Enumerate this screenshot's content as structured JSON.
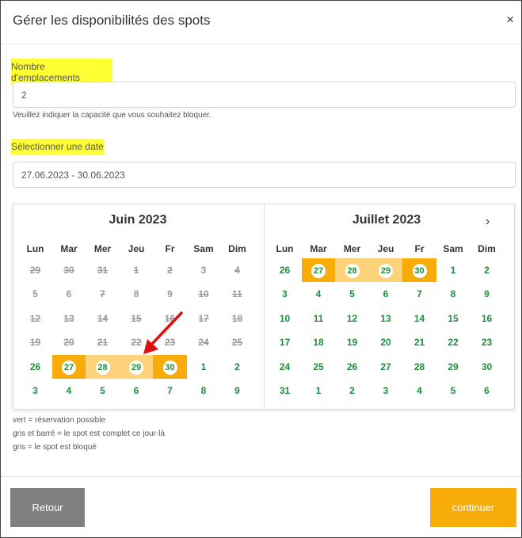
{
  "modal": {
    "title": "Gérer les disponibilités des spots",
    "close_label": "×"
  },
  "capacity": {
    "label": "Nombre d'emplacements",
    "value": "2",
    "help": "Veuillez indiquer la capacité que vous souhaitez bloquer."
  },
  "date": {
    "label": "Sélectionner une date",
    "value": "27.06.2023 - 30.06.2023"
  },
  "calendar": {
    "weekdays": [
      "Lun",
      "Mar",
      "Mer",
      "Jeu",
      "Fr",
      "Sam",
      "Dim"
    ],
    "next_label": "›",
    "months": [
      {
        "title": "Juin 2023",
        "weeks": [
          [
            {
              "d": "29",
              "s": "full"
            },
            {
              "d": "30",
              "s": "full"
            },
            {
              "d": "31",
              "s": "full"
            },
            {
              "d": "1",
              "s": "full"
            },
            {
              "d": "2",
              "s": "full"
            },
            {
              "d": "3",
              "s": "blocked"
            },
            {
              "d": "4",
              "s": "full"
            }
          ],
          [
            {
              "d": "5",
              "s": "blocked"
            },
            {
              "d": "6",
              "s": "blocked"
            },
            {
              "d": "7",
              "s": "full"
            },
            {
              "d": "8",
              "s": "blocked"
            },
            {
              "d": "9",
              "s": "blocked"
            },
            {
              "d": "10",
              "s": "full"
            },
            {
              "d": "11",
              "s": "full"
            }
          ],
          [
            {
              "d": "12",
              "s": "full"
            },
            {
              "d": "13",
              "s": "full"
            },
            {
              "d": "14",
              "s": "full"
            },
            {
              "d": "15",
              "s": "full"
            },
            {
              "d": "16",
              "s": "full"
            },
            {
              "d": "17",
              "s": "full"
            },
            {
              "d": "18",
              "s": "full"
            }
          ],
          [
            {
              "d": "19",
              "s": "full"
            },
            {
              "d": "20",
              "s": "full"
            },
            {
              "d": "21",
              "s": "full"
            },
            {
              "d": "22",
              "s": "full"
            },
            {
              "d": "23",
              "s": "full"
            },
            {
              "d": "24",
              "s": "full"
            },
            {
              "d": "25",
              "s": "full"
            }
          ],
          [
            {
              "d": "26",
              "s": "avail"
            },
            {
              "d": "27",
              "s": "avail",
              "sel": "end"
            },
            {
              "d": "28",
              "s": "avail",
              "sel": "mid"
            },
            {
              "d": "29",
              "s": "avail",
              "sel": "mid"
            },
            {
              "d": "30",
              "s": "avail",
              "sel": "end"
            },
            {
              "d": "1",
              "s": "avail"
            },
            {
              "d": "2",
              "s": "avail"
            }
          ],
          [
            {
              "d": "3",
              "s": "avail"
            },
            {
              "d": "4",
              "s": "avail"
            },
            {
              "d": "5",
              "s": "avail"
            },
            {
              "d": "6",
              "s": "avail"
            },
            {
              "d": "7",
              "s": "avail"
            },
            {
              "d": "8",
              "s": "avail"
            },
            {
              "d": "9",
              "s": "avail"
            }
          ]
        ]
      },
      {
        "title": "Juillet 2023",
        "weeks": [
          [
            {
              "d": "26",
              "s": "avail"
            },
            {
              "d": "27",
              "s": "avail",
              "sel": "end"
            },
            {
              "d": "28",
              "s": "avail",
              "sel": "mid"
            },
            {
              "d": "29",
              "s": "avail",
              "sel": "mid"
            },
            {
              "d": "30",
              "s": "avail",
              "sel": "end"
            },
            {
              "d": "1",
              "s": "avail"
            },
            {
              "d": "2",
              "s": "avail"
            }
          ],
          [
            {
              "d": "3",
              "s": "avail"
            },
            {
              "d": "4",
              "s": "avail"
            },
            {
              "d": "5",
              "s": "avail"
            },
            {
              "d": "6",
              "s": "avail"
            },
            {
              "d": "7",
              "s": "avail"
            },
            {
              "d": "8",
              "s": "avail"
            },
            {
              "d": "9",
              "s": "avail"
            }
          ],
          [
            {
              "d": "10",
              "s": "avail"
            },
            {
              "d": "11",
              "s": "avail"
            },
            {
              "d": "12",
              "s": "avail"
            },
            {
              "d": "13",
              "s": "avail"
            },
            {
              "d": "14",
              "s": "avail"
            },
            {
              "d": "15",
              "s": "avail"
            },
            {
              "d": "16",
              "s": "avail"
            }
          ],
          [
            {
              "d": "17",
              "s": "avail"
            },
            {
              "d": "18",
              "s": "avail"
            },
            {
              "d": "19",
              "s": "avail"
            },
            {
              "d": "20",
              "s": "avail"
            },
            {
              "d": "21",
              "s": "avail"
            },
            {
              "d": "22",
              "s": "avail"
            },
            {
              "d": "23",
              "s": "avail"
            }
          ],
          [
            {
              "d": "24",
              "s": "avail"
            },
            {
              "d": "25",
              "s": "avail"
            },
            {
              "d": "26",
              "s": "avail"
            },
            {
              "d": "27",
              "s": "avail"
            },
            {
              "d": "28",
              "s": "avail"
            },
            {
              "d": "29",
              "s": "avail"
            },
            {
              "d": "30",
              "s": "avail"
            }
          ],
          [
            {
              "d": "31",
              "s": "avail"
            },
            {
              "d": "1",
              "s": "avail"
            },
            {
              "d": "2",
              "s": "avail"
            },
            {
              "d": "3",
              "s": "avail"
            },
            {
              "d": "4",
              "s": "avail"
            },
            {
              "d": "5",
              "s": "avail"
            },
            {
              "d": "6",
              "s": "avail"
            }
          ]
        ]
      }
    ]
  },
  "legend": [
    "vert = réservation possible",
    "gris et barré = le spot est complet ce jour-là",
    "gris = le spot est bloqué"
  ],
  "buttons": {
    "back": "Retour",
    "continue": "continuer"
  },
  "colors": {
    "available": "#1c8f3a",
    "unavailable": "#9a9a9a",
    "selection_end": "#f7ac0a",
    "selection_mid": "#fcd37a",
    "highlight": "#ffff33",
    "annotation_arrow": "#e01010"
  }
}
